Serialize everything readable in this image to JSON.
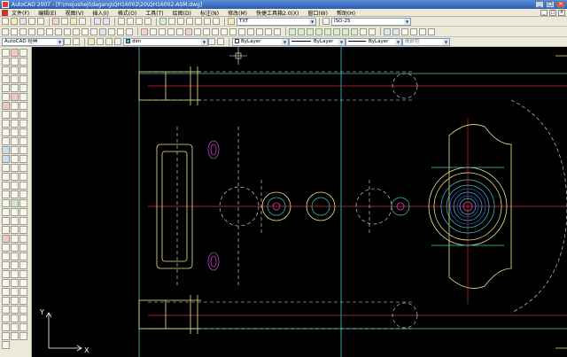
{
  "window": {
    "title": "AutoCAD 2007 - [F:\\mojusheji\\dagang\\QH16002\\20\\QH16002-ASM.dwg]",
    "controls": [
      "_",
      "□",
      "×"
    ]
  },
  "menu": {
    "items": [
      "文件(F)",
      "编辑(E)",
      "视图(V)",
      "插入(I)",
      "格式(O)",
      "工具(T)",
      "绘图(D)",
      "标注(N)",
      "修改(M)",
      "快捷工具箱2.0(X)",
      "窗口(W)",
      "帮助(H)"
    ],
    "mdi_controls": [
      "_",
      "□",
      "×"
    ]
  },
  "toolbar": {
    "text_style": "TXT",
    "dim_style": "ISO-25",
    "workspace": "AutoCAD 经典",
    "layer": "dim",
    "color": "ByLayer",
    "linetype": "ByLayer",
    "lineweight": "ByLayer",
    "plot_style": "随颜色"
  },
  "colors": {
    "chrome": "#ece9d8",
    "canvas": "#000000",
    "geometry_yellow": "#f0e68c",
    "geometry_cyan": "#3fc8c8",
    "centerline_red": "#d63030",
    "hidden_dashed": "#e8e8e8",
    "detail_magenta": "#d040d0",
    "detail_blue": "#3050e0"
  },
  "ucs": {
    "x_label": "X",
    "y_label": "Y"
  }
}
